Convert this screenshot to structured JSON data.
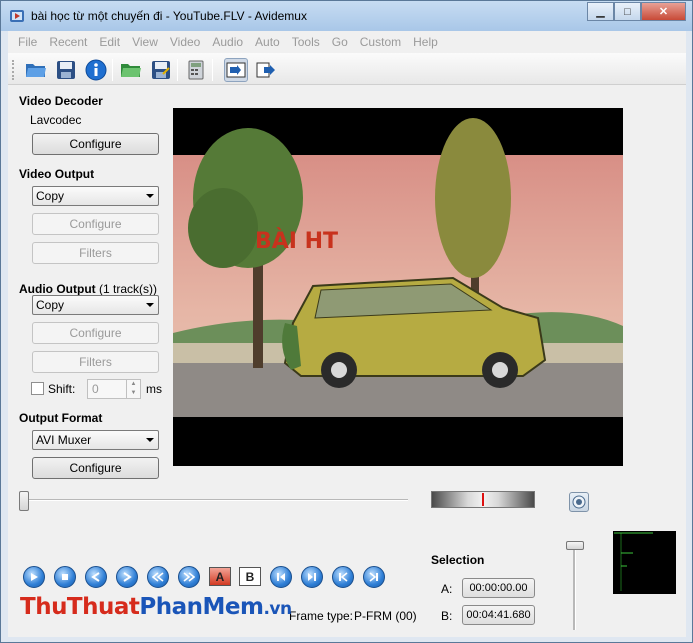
{
  "window": {
    "title": "bài học từ một chuyến đi - YouTube.FLV - Avidemux",
    "minimize": "▁",
    "maximize": "□",
    "close": "✕"
  },
  "menu": [
    "File",
    "Recent",
    "Edit",
    "View",
    "Video",
    "Audio",
    "Auto",
    "Tools",
    "Go",
    "Custom",
    "Help"
  ],
  "toolbar": {
    "icons": [
      "open-folder-icon",
      "save-icon",
      "info-icon",
      "open-green-folder-icon",
      "save-as-icon",
      "calculator-icon",
      "input-preview-icon",
      "output-preview-icon"
    ]
  },
  "video_decoder": {
    "title": "Video Decoder",
    "codec": "Lavcodec",
    "configure": "Configure"
  },
  "video_output": {
    "title": "Video Output",
    "selected": "Copy",
    "configure": "Configure",
    "filters": "Filters"
  },
  "audio_output": {
    "title": "Audio Output",
    "tracks": "(1 track(s))",
    "selected": "Copy",
    "configure": "Configure",
    "filters": "Filters",
    "shift_label": "Shift:",
    "shift_value": "0",
    "shift_unit": "ms"
  },
  "output_format": {
    "title": "Output Format",
    "selected": "AVI Muxer",
    "configure": "Configure"
  },
  "video_frame": {
    "overlay_text": "BÀI HT"
  },
  "playback": {
    "marker_a": "A",
    "marker_b": "B",
    "frame_type_label": "Frame type:",
    "frame_type_value": "P-FRM (00)"
  },
  "selection": {
    "title": "Selection",
    "a_label": "A:",
    "a_value": "00:00:00.00",
    "b_label": "B:",
    "b_value": "00:04:41.680"
  },
  "watermark": {
    "part1": "ThuThuat",
    "part2": "PhanMem",
    "part3": ".vn"
  },
  "colors": {
    "watermark_red": "#d62b1c",
    "watermark_blue": "#1a55b8",
    "accent_blue": "#2f7fd6"
  }
}
